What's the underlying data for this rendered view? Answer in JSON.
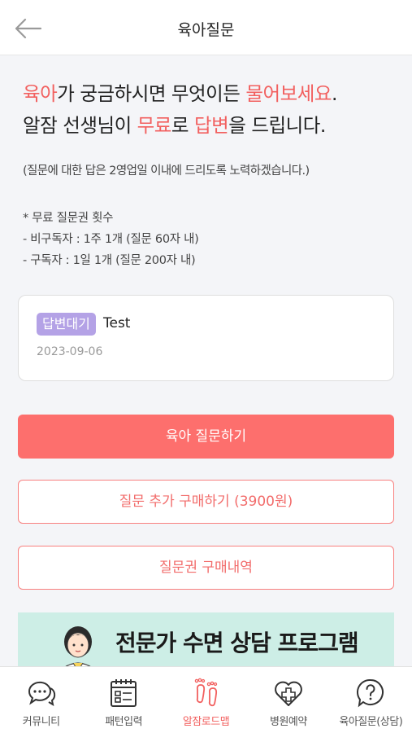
{
  "header": {
    "title": "육아질문"
  },
  "intro": {
    "line1": [
      {
        "text": "육아",
        "hl": true
      },
      {
        "text": "가 궁금하시면 무엇이든 ",
        "hl": false
      },
      {
        "text": "물어보세요",
        "hl": true
      },
      {
        "text": ".",
        "hl": false
      }
    ],
    "line2": [
      {
        "text": "알잠 선생님이 ",
        "hl": false
      },
      {
        "text": "무료",
        "hl": true
      },
      {
        "text": "로 ",
        "hl": false
      },
      {
        "text": "답변",
        "hl": true
      },
      {
        "text": "을 드립니다.",
        "hl": false
      }
    ],
    "note": "(질문에 대한 답은 2영업일 이내에 드리도록 노력하겠습니다.)",
    "quota_title": "* 무료 질문권 횟수",
    "quota_lines": [
      "- 비구독자 : 1주 1개 (질문 60자 내)",
      "- 구독자 : 1일 1개 (질문 200자 내)"
    ]
  },
  "question": {
    "status": "답변대기",
    "title": "Test",
    "date": "2023-09-06"
  },
  "buttons": {
    "ask": "육아 질문하기",
    "buy_more": "질문 추가 구매하기 (3900원)",
    "history": "질문권 구매내역"
  },
  "banner": {
    "title": "전문가 수면 상담 프로그램"
  },
  "tabs": [
    {
      "label": "커뮤니티",
      "icon": "chat-bubbles-icon",
      "active": false
    },
    {
      "label": "패턴입력",
      "icon": "calendar-icon",
      "active": false
    },
    {
      "label": "알잠로드맵",
      "icon": "footprints-icon",
      "active": true
    },
    {
      "label": "병원예약",
      "icon": "heart-plus-icon",
      "active": false
    },
    {
      "label": "육아질문(상담)",
      "icon": "question-icon",
      "active": false
    }
  ],
  "colors": {
    "accent": "#f2605f",
    "button": "#fd6f6d",
    "badge": "#b4a2e6",
    "banner_bg": "#cdeee6"
  }
}
